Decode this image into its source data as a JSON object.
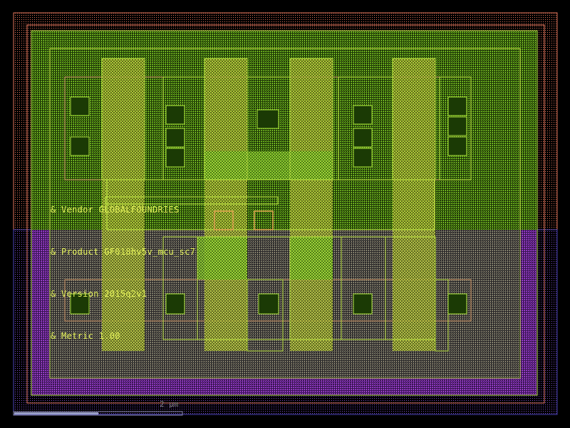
{
  "annotations": {
    "vendor": "& Vendor GLOBALFOUNDRIES",
    "product": "& Product GF018hv5v_mcu_sc7",
    "version": "& Version 2015q2v1",
    "metric": "& Metric 1.00"
  },
  "scale_bar": {
    "label": "2 µm"
  },
  "colors": {
    "background": "#000000",
    "nwell": "#e0745a",
    "pwell": "#8a2bd6",
    "substrate": "#3f3aa8",
    "diffusion": "#8fd21a",
    "poly": "#e8d93a",
    "metal": "#9bdb3d",
    "text": "#e4f25a"
  }
}
